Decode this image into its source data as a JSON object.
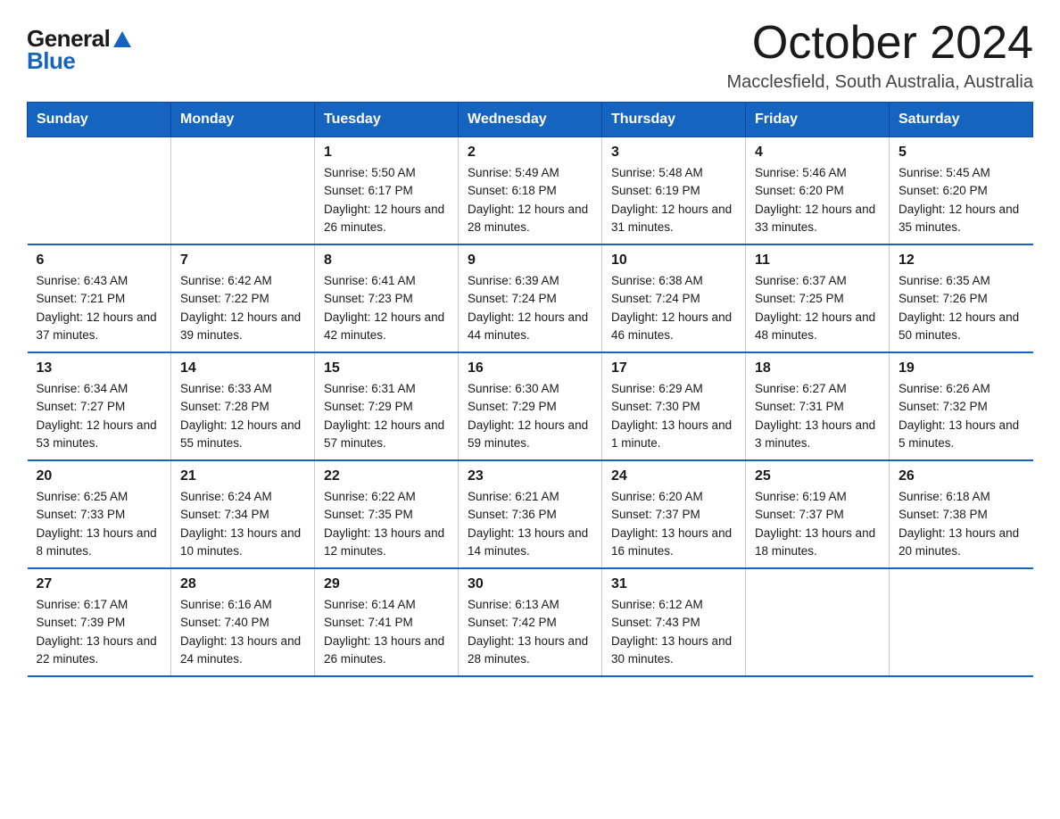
{
  "logo": {
    "general": "General",
    "blue": "Blue"
  },
  "title": "October 2024",
  "subtitle": "Macclesfield, South Australia, Australia",
  "weekdays": [
    "Sunday",
    "Monday",
    "Tuesday",
    "Wednesday",
    "Thursday",
    "Friday",
    "Saturday"
  ],
  "weeks": [
    [
      {
        "day": "",
        "info": ""
      },
      {
        "day": "",
        "info": ""
      },
      {
        "day": "1",
        "sunrise": "5:50 AM",
        "sunset": "6:17 PM",
        "daylight": "12 hours and 26 minutes"
      },
      {
        "day": "2",
        "sunrise": "5:49 AM",
        "sunset": "6:18 PM",
        "daylight": "12 hours and 28 minutes"
      },
      {
        "day": "3",
        "sunrise": "5:48 AM",
        "sunset": "6:19 PM",
        "daylight": "12 hours and 31 minutes"
      },
      {
        "day": "4",
        "sunrise": "5:46 AM",
        "sunset": "6:20 PM",
        "daylight": "12 hours and 33 minutes"
      },
      {
        "day": "5",
        "sunrise": "5:45 AM",
        "sunset": "6:20 PM",
        "daylight": "12 hours and 35 minutes"
      }
    ],
    [
      {
        "day": "6",
        "sunrise": "6:43 AM",
        "sunset": "7:21 PM",
        "daylight": "12 hours and 37 minutes"
      },
      {
        "day": "7",
        "sunrise": "6:42 AM",
        "sunset": "7:22 PM",
        "daylight": "12 hours and 39 minutes"
      },
      {
        "day": "8",
        "sunrise": "6:41 AM",
        "sunset": "7:23 PM",
        "daylight": "12 hours and 42 minutes"
      },
      {
        "day": "9",
        "sunrise": "6:39 AM",
        "sunset": "7:24 PM",
        "daylight": "12 hours and 44 minutes"
      },
      {
        "day": "10",
        "sunrise": "6:38 AM",
        "sunset": "7:24 PM",
        "daylight": "12 hours and 46 minutes"
      },
      {
        "day": "11",
        "sunrise": "6:37 AM",
        "sunset": "7:25 PM",
        "daylight": "12 hours and 48 minutes"
      },
      {
        "day": "12",
        "sunrise": "6:35 AM",
        "sunset": "7:26 PM",
        "daylight": "12 hours and 50 minutes"
      }
    ],
    [
      {
        "day": "13",
        "sunrise": "6:34 AM",
        "sunset": "7:27 PM",
        "daylight": "12 hours and 53 minutes"
      },
      {
        "day": "14",
        "sunrise": "6:33 AM",
        "sunset": "7:28 PM",
        "daylight": "12 hours and 55 minutes"
      },
      {
        "day": "15",
        "sunrise": "6:31 AM",
        "sunset": "7:29 PM",
        "daylight": "12 hours and 57 minutes"
      },
      {
        "day": "16",
        "sunrise": "6:30 AM",
        "sunset": "7:29 PM",
        "daylight": "12 hours and 59 minutes"
      },
      {
        "day": "17",
        "sunrise": "6:29 AM",
        "sunset": "7:30 PM",
        "daylight": "13 hours and 1 minute"
      },
      {
        "day": "18",
        "sunrise": "6:27 AM",
        "sunset": "7:31 PM",
        "daylight": "13 hours and 3 minutes"
      },
      {
        "day": "19",
        "sunrise": "6:26 AM",
        "sunset": "7:32 PM",
        "daylight": "13 hours and 5 minutes"
      }
    ],
    [
      {
        "day": "20",
        "sunrise": "6:25 AM",
        "sunset": "7:33 PM",
        "daylight": "13 hours and 8 minutes"
      },
      {
        "day": "21",
        "sunrise": "6:24 AM",
        "sunset": "7:34 PM",
        "daylight": "13 hours and 10 minutes"
      },
      {
        "day": "22",
        "sunrise": "6:22 AM",
        "sunset": "7:35 PM",
        "daylight": "13 hours and 12 minutes"
      },
      {
        "day": "23",
        "sunrise": "6:21 AM",
        "sunset": "7:36 PM",
        "daylight": "13 hours and 14 minutes"
      },
      {
        "day": "24",
        "sunrise": "6:20 AM",
        "sunset": "7:37 PM",
        "daylight": "13 hours and 16 minutes"
      },
      {
        "day": "25",
        "sunrise": "6:19 AM",
        "sunset": "7:37 PM",
        "daylight": "13 hours and 18 minutes"
      },
      {
        "day": "26",
        "sunrise": "6:18 AM",
        "sunset": "7:38 PM",
        "daylight": "13 hours and 20 minutes"
      }
    ],
    [
      {
        "day": "27",
        "sunrise": "6:17 AM",
        "sunset": "7:39 PM",
        "daylight": "13 hours and 22 minutes"
      },
      {
        "day": "28",
        "sunrise": "6:16 AM",
        "sunset": "7:40 PM",
        "daylight": "13 hours and 24 minutes"
      },
      {
        "day": "29",
        "sunrise": "6:14 AM",
        "sunset": "7:41 PM",
        "daylight": "13 hours and 26 minutes"
      },
      {
        "day": "30",
        "sunrise": "6:13 AM",
        "sunset": "7:42 PM",
        "daylight": "13 hours and 28 minutes"
      },
      {
        "day": "31",
        "sunrise": "6:12 AM",
        "sunset": "7:43 PM",
        "daylight": "13 hours and 30 minutes"
      },
      {
        "day": "",
        "info": ""
      },
      {
        "day": "",
        "info": ""
      }
    ]
  ]
}
